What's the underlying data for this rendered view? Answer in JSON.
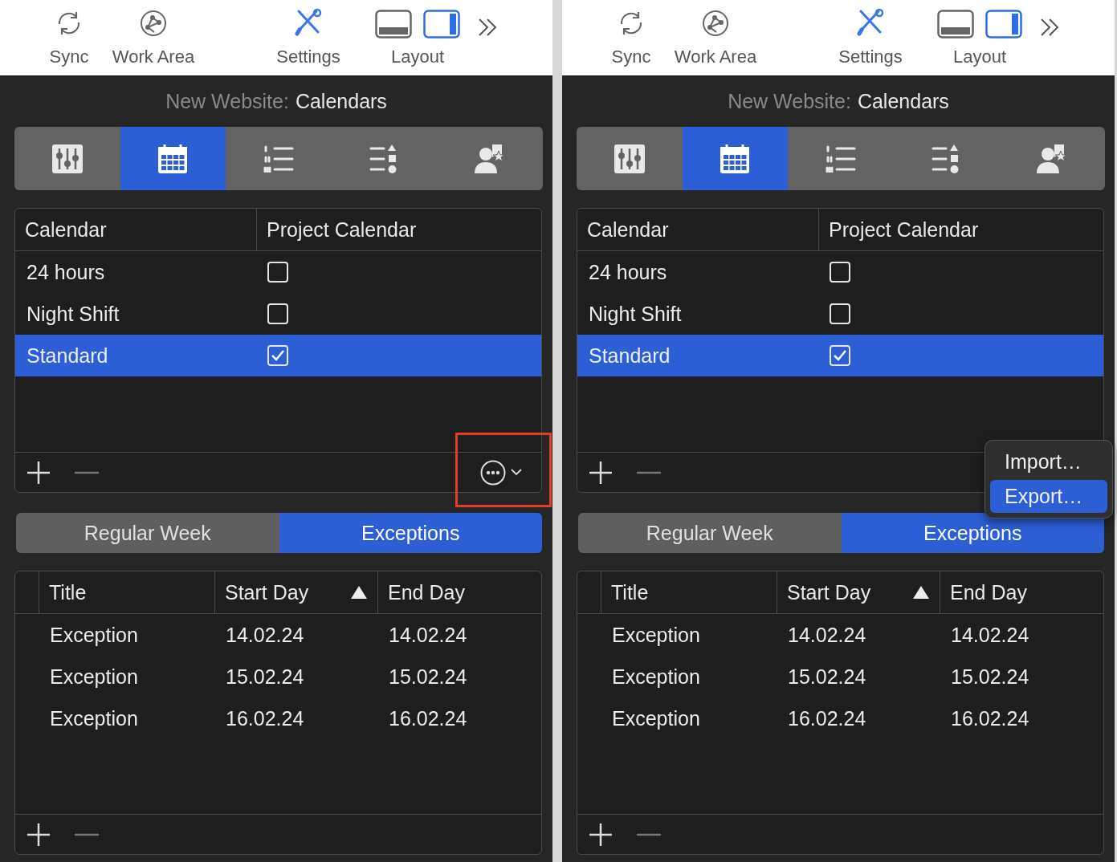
{
  "panels": [
    {
      "toolbar": {
        "items": [
          {
            "kind": "sync",
            "label": "Sync"
          },
          {
            "kind": "workarea",
            "label": "Work Area"
          },
          {
            "kind": "settings",
            "label": "Settings"
          }
        ],
        "layout": {
          "label": "Layout",
          "options": [
            {
              "kind": "bottom",
              "selected": false
            },
            {
              "kind": "side",
              "selected": true
            }
          ]
        }
      },
      "header": {
        "project": "New Website:",
        "section": "Calendars"
      },
      "tabs": [
        {
          "kind": "sliders",
          "selected": false
        },
        {
          "kind": "calendar",
          "selected": true
        },
        {
          "kind": "numbered-list",
          "selected": false
        },
        {
          "kind": "shapes-list",
          "selected": false
        },
        {
          "kind": "person-star",
          "selected": false
        }
      ],
      "calendars": {
        "columns": [
          "Calendar",
          "Project Calendar"
        ],
        "rows": [
          {
            "name": "24 hours",
            "project_calendar": false,
            "selected": false
          },
          {
            "name": "Night Shift",
            "project_calendar": false,
            "selected": false
          },
          {
            "name": "Standard",
            "project_calendar": true,
            "selected": true
          }
        ],
        "more_button": {
          "highlighted": true
        }
      },
      "segments": [
        {
          "label": "Regular Week",
          "selected": false
        },
        {
          "label": "Exceptions",
          "selected": true
        }
      ],
      "exceptions": {
        "columns": [
          {
            "label": "Title",
            "sorted": false
          },
          {
            "label": "Start Day",
            "sorted": true
          },
          {
            "label": "End Day",
            "sorted": false
          }
        ],
        "rows": [
          [
            "Exception",
            "14.02.24",
            "14.02.24"
          ],
          [
            "Exception",
            "15.02.24",
            "15.02.24"
          ],
          [
            "Exception",
            "16.02.24",
            "16.02.24"
          ]
        ]
      }
    },
    {
      "toolbar": {
        "items": [
          {
            "kind": "sync",
            "label": "Sync"
          },
          {
            "kind": "workarea",
            "label": "Work Area"
          },
          {
            "kind": "settings",
            "label": "Settings"
          }
        ],
        "layout": {
          "label": "Layout",
          "options": [
            {
              "kind": "bottom",
              "selected": false
            },
            {
              "kind": "side",
              "selected": true
            }
          ]
        }
      },
      "header": {
        "project": "New Website:",
        "section": "Calendars"
      },
      "tabs": [
        {
          "kind": "sliders",
          "selected": false
        },
        {
          "kind": "calendar",
          "selected": true
        },
        {
          "kind": "numbered-list",
          "selected": false
        },
        {
          "kind": "shapes-list",
          "selected": false
        },
        {
          "kind": "person-star",
          "selected": false
        }
      ],
      "calendars": {
        "columns": [
          "Calendar",
          "Project Calendar"
        ],
        "rows": [
          {
            "name": "24 hours",
            "project_calendar": false,
            "selected": false
          },
          {
            "name": "Night Shift",
            "project_calendar": false,
            "selected": false
          },
          {
            "name": "Standard",
            "project_calendar": true,
            "selected": true
          }
        ],
        "menu": [
          {
            "label": "Import…",
            "selected": false
          },
          {
            "label": "Export…",
            "selected": true
          }
        ]
      },
      "segments": [
        {
          "label": "Regular Week",
          "selected": false
        },
        {
          "label": "Exceptions",
          "selected": true
        }
      ],
      "exceptions": {
        "columns": [
          {
            "label": "Title",
            "sorted": false
          },
          {
            "label": "Start Day",
            "sorted": true
          },
          {
            "label": "End Day",
            "sorted": false
          }
        ],
        "rows": [
          [
            "Exception",
            "14.02.24",
            "14.02.24"
          ],
          [
            "Exception",
            "15.02.24",
            "15.02.24"
          ],
          [
            "Exception",
            "16.02.24",
            "16.02.24"
          ]
        ]
      }
    }
  ]
}
